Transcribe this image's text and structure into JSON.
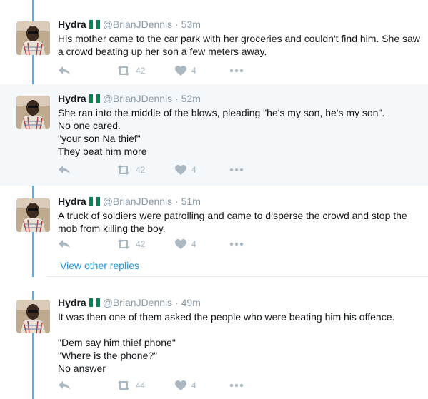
{
  "colors": {
    "thread_line": "#4ab3f4",
    "link": "#1b95e0",
    "muted": "#8899a6",
    "shaded_bg": "#f5f8fa"
  },
  "tweets": [
    {
      "name": "Hydra",
      "handle": "@BrianJDennis",
      "separator": "·",
      "time": "53m",
      "lines": [
        "His mother came to the car park with her groceries and couldn't find him. She saw a crowd beating up her son a few meters away."
      ],
      "retweets": "42",
      "likes": "4"
    },
    {
      "name": "Hydra",
      "handle": "@BrianJDennis",
      "separator": "·",
      "time": "52m",
      "lines": [
        "She ran into the middle of the blows, pleading \"he's my son, he's my son\".",
        "No one cared.",
        "\"your son Na thief\"",
        "They beat him more"
      ],
      "retweets": "42",
      "likes": "4"
    },
    {
      "name": "Hydra",
      "handle": "@BrianJDennis",
      "separator": "·",
      "time": "51m",
      "lines": [
        "A truck of soldiers were patrolling and came to disperse the crowd and stop the mob from killing the boy."
      ],
      "retweets": "42",
      "likes": "4"
    },
    {
      "name": "Hydra",
      "handle": "@BrianJDennis",
      "separator": "·",
      "time": "49m",
      "lines": [
        "It was then one of them asked the people who were beating him his offence.",
        "",
        "\"Dem say him thief phone\"",
        "\"Where is the phone?\"",
        "No answer"
      ],
      "retweets": "44",
      "likes": "4"
    }
  ],
  "view_other_replies": "View other replies",
  "icons": {
    "reply": "reply-icon",
    "retweet": "retweet-icon",
    "like": "heart-icon",
    "more": "more-icon"
  }
}
